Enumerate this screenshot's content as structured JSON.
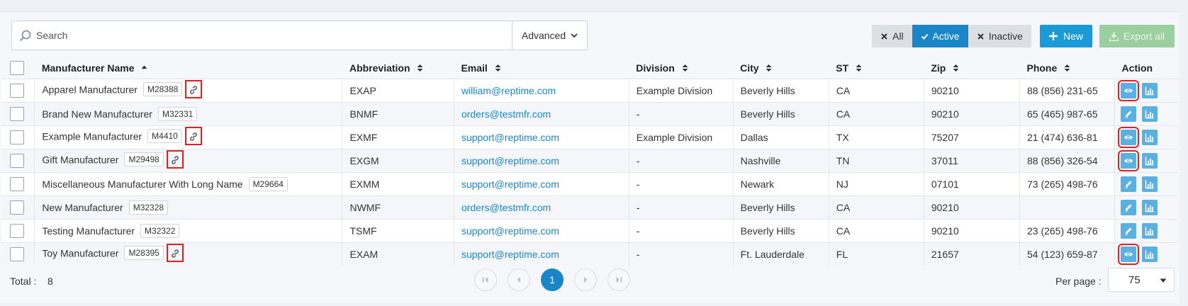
{
  "search": {
    "placeholder": "Search",
    "advanced_label": "Advanced"
  },
  "filters": {
    "all": "All",
    "active": "Active",
    "inactive": "Inactive"
  },
  "actions": {
    "new_label": "New",
    "export_label": "Export all"
  },
  "columns": {
    "name": "Manufacturer Name",
    "abbreviation": "Abbreviation",
    "email": "Email",
    "division": "Division",
    "city": "City",
    "st": "ST",
    "zip": "Zip",
    "phone": "Phone",
    "action": "Action"
  },
  "rows": [
    {
      "name": "Apparel Manufacturer",
      "code": "M28388",
      "linked": true,
      "abbr": "EXAP",
      "email": "william@reptime.com",
      "division": "Example Division",
      "city": "Beverly Hills",
      "st": "CA",
      "zip": "90210",
      "phone": "88 (856) 231-65",
      "action": "view-icon"
    },
    {
      "name": "Brand New Manufacturer",
      "code": "M32331",
      "linked": false,
      "abbr": "BNMF",
      "email": "orders@testmfr.com",
      "division": "-",
      "city": "Beverly Hills",
      "st": "CA",
      "zip": "90210",
      "phone": "65 (465) 987-65",
      "action": "edit-icon"
    },
    {
      "name": "Example Manufacturer",
      "code": "M4410",
      "linked": true,
      "abbr": "EXMF",
      "email": "support@reptime.com",
      "division": "Example Division",
      "city": "Dallas",
      "st": "TX",
      "zip": "75207",
      "phone": "21 (474) 636-81",
      "action": "view-icon"
    },
    {
      "name": "Gift Manufacturer",
      "code": "M29498",
      "linked": true,
      "abbr": "EXGM",
      "email": "support@reptime.com",
      "division": "-",
      "city": "Nashville",
      "st": "TN",
      "zip": "37011",
      "phone": "88 (856) 326-54",
      "action": "view-icon"
    },
    {
      "name": "Miscellaneous Manufacturer With Long Name",
      "code": "M29664",
      "linked": false,
      "abbr": "EXMM",
      "email": "support@reptime.com",
      "division": "-",
      "city": "Newark",
      "st": "NJ",
      "zip": "07101",
      "phone": "73 (265) 498-76",
      "action": "edit-icon"
    },
    {
      "name": "New Manufacturer",
      "code": "M32328",
      "linked": false,
      "abbr": "NWMF",
      "email": "orders@testmfr.com",
      "division": "-",
      "city": "Beverly Hills",
      "st": "CA",
      "zip": "90210",
      "phone": "",
      "action": "edit-icon"
    },
    {
      "name": "Testing Manufacturer",
      "code": "M32322",
      "linked": false,
      "abbr": "TSMF",
      "email": "support@reptime.com",
      "division": "-",
      "city": "Beverly Hills",
      "st": "CA",
      "zip": "90210",
      "phone": "23 (265) 498-76",
      "action": "edit-icon"
    },
    {
      "name": "Toy Manufacturer",
      "code": "M28395",
      "linked": true,
      "abbr": "EXAM",
      "email": "support@reptime.com",
      "division": "-",
      "city": "Ft. Lauderdale",
      "st": "FL",
      "zip": "21657",
      "phone": "54 (123) 659-87",
      "action": "view-icon"
    }
  ],
  "footer": {
    "total_label": "Total :",
    "total_value": "8",
    "current_page": "1",
    "per_page_label": "Per page :",
    "per_page_value": "75"
  },
  "colors": {
    "accent": "#1a86c8",
    "highlight": "#e0201f",
    "export": "#9ccf9f"
  }
}
